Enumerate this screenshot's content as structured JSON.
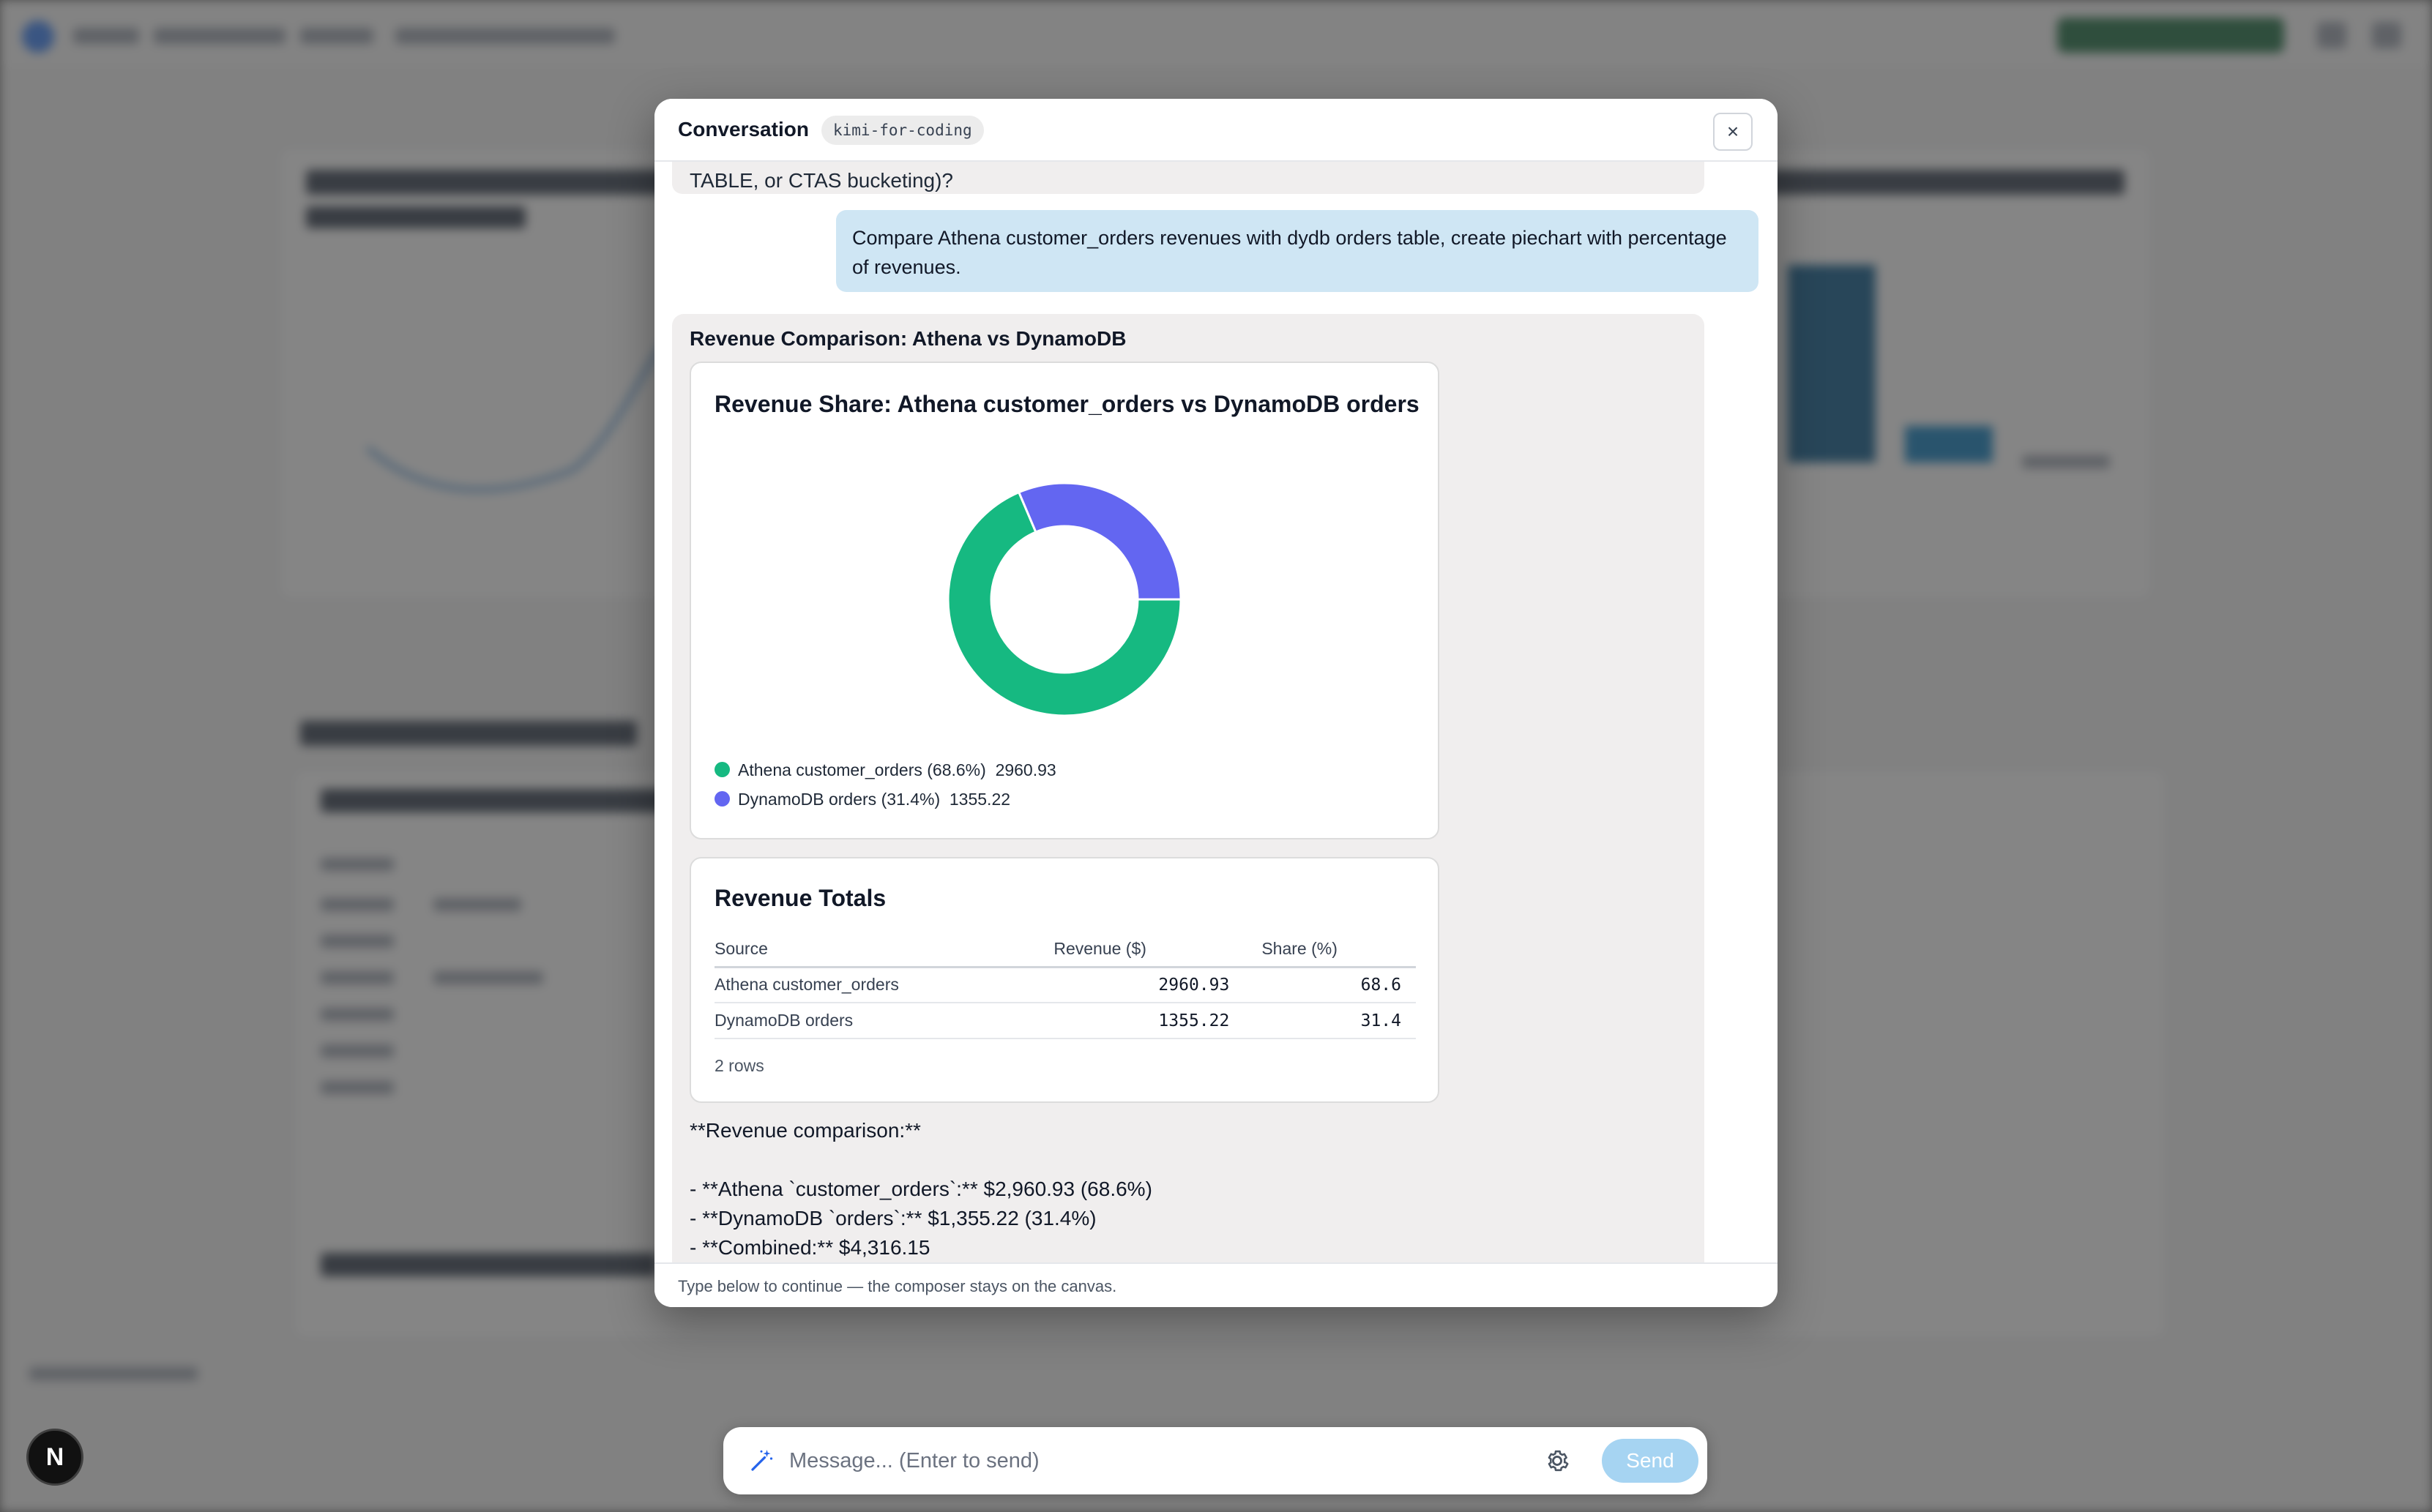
{
  "modal": {
    "title": "Conversation",
    "model_badge": "kimi-for-coding",
    "close_glyph": "×",
    "previous_message_tail": "TABLE, or CTAS bucketing)?",
    "user_message": "Compare Athena customer_orders revenues with dydb orders table, create piechart with percentage of revenues.",
    "assistant": {
      "section_heading": "Revenue Comparison: Athena vs DynamoDB",
      "chart": {
        "title": "Revenue Share: Athena customer_orders vs DynamoDB orders",
        "legend": [
          {
            "label": "Athena customer_orders (68.6%)",
            "value": "2960.93",
            "color": "#16b981"
          },
          {
            "label": "DynamoDB orders (31.4%)",
            "value": "1355.22",
            "color": "#6366f1"
          }
        ]
      },
      "table": {
        "title": "Revenue Totals",
        "headers": [
          "Source",
          "Revenue ($)",
          "Share (%)"
        ],
        "rows": [
          [
            "Athena customer_orders",
            "2960.93",
            "68.6"
          ],
          [
            "DynamoDB orders",
            "1355.22",
            "31.4"
          ]
        ],
        "row_count_label": "2 rows"
      },
      "summary": {
        "heading": "**Revenue comparison:**",
        "bullets": [
          "- **Athena `customer_orders`:** $2,960.93 (68.6%)",
          "- **DynamoDB `orders`:** $1,355.22 (31.4%)",
          "- **Combined:** $4,316.15"
        ]
      }
    },
    "footer_note": "Type below to continue — the composer stays on the canvas."
  },
  "chart_data": {
    "type": "pie",
    "title": "Revenue Share: Athena customer_orders vs DynamoDB orders",
    "categories": [
      "Athena customer_orders",
      "DynamoDB orders"
    ],
    "values": [
      2960.93,
      1355.22
    ],
    "percentages": [
      68.6,
      31.4
    ],
    "colors": [
      "#16b981",
      "#6366f1"
    ],
    "donut": true,
    "legend_position": "bottom-left"
  },
  "composer": {
    "placeholder": "Message... (Enter to send)",
    "send_label": "Send"
  },
  "avatar": {
    "letter": "N"
  },
  "icons": [
    "close-icon",
    "magic-wand-icon",
    "gear-icon"
  ],
  "colors": {
    "user_bubble": "#cfe6f4",
    "assistant_bubble": "#f0eeee",
    "send_button": "#a6d4f2"
  }
}
